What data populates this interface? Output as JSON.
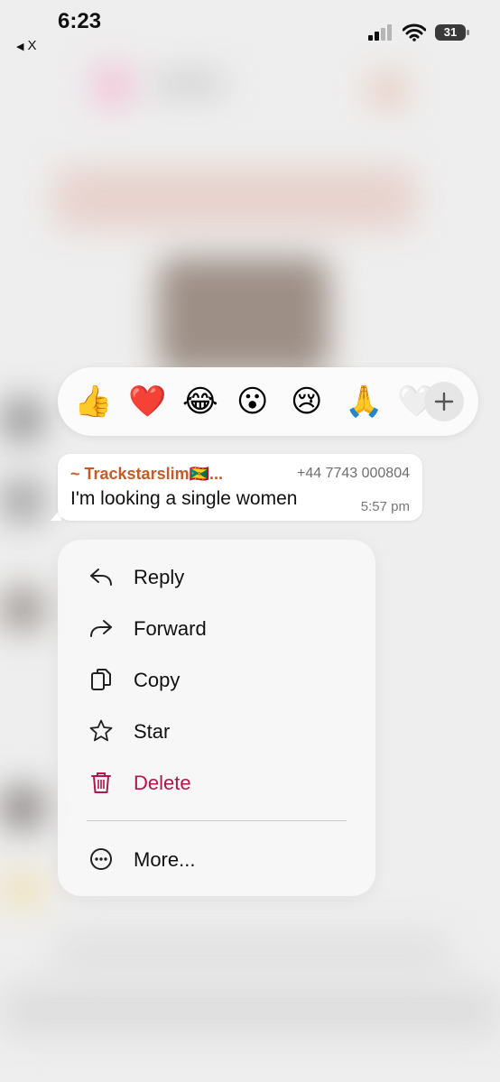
{
  "status_bar": {
    "time": "6:23",
    "back_app": "X",
    "battery": "31"
  },
  "reactions": {
    "emojis": [
      "👍",
      "❤️",
      "😂",
      "😮",
      "😢",
      "🙏",
      "🤍"
    ],
    "more_label": "+"
  },
  "message": {
    "sender": "~ Trackstarslim🇬🇩...",
    "phone": "+44 7743 000804",
    "text": "I'm looking a single women",
    "time": "5:57 pm"
  },
  "menu": {
    "items": [
      {
        "label": "Reply",
        "icon": "reply-icon"
      },
      {
        "label": "Forward",
        "icon": "forward-icon"
      },
      {
        "label": "Copy",
        "icon": "copy-icon"
      },
      {
        "label": "Star",
        "icon": "star-icon"
      },
      {
        "label": "Delete",
        "icon": "trash-icon"
      }
    ],
    "more": {
      "label": "More...",
      "icon": "more-icon"
    }
  },
  "colors": {
    "sender": "#c35a27",
    "delete": "#b0174a",
    "background": "#eeeeee"
  }
}
